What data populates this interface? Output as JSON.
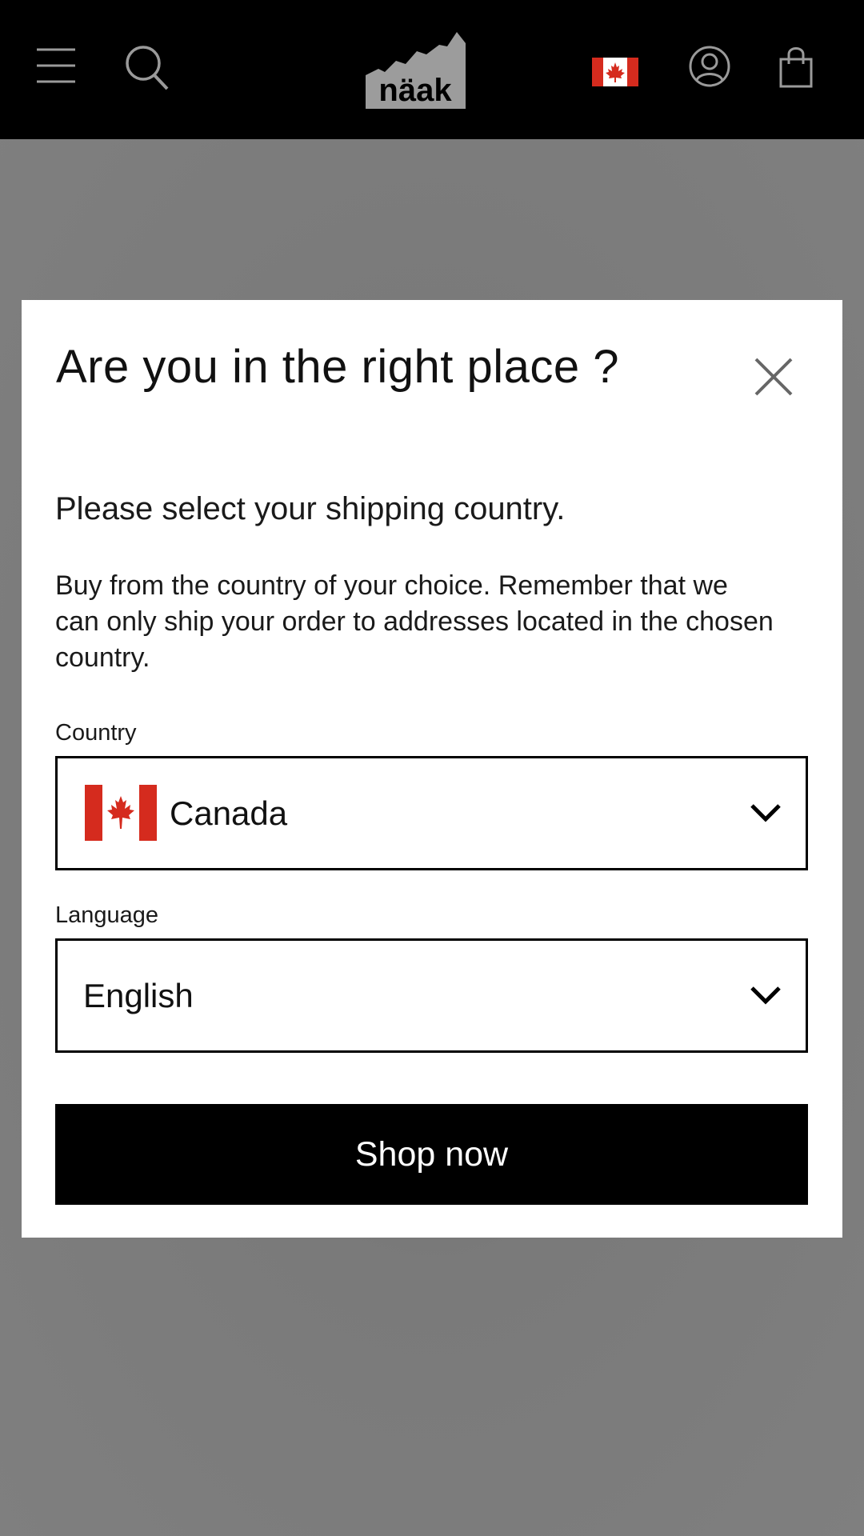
{
  "header": {
    "logo_text": "näak",
    "icons": {
      "menu": "hamburger-menu-icon",
      "search": "search-icon",
      "flag": "canada-flag-icon",
      "account": "account-icon",
      "cart": "shopping-bag-icon"
    },
    "background": "#000000"
  },
  "modal": {
    "title": "Are you in the right place ?",
    "subtitle": "Please select your shipping country.",
    "description": "Buy from the country of your choice. Remember that we can only ship your order to addresses located in the chosen country.",
    "country": {
      "label": "Country",
      "value": "Canada",
      "flag_icon": "canada-flag-icon"
    },
    "language": {
      "label": "Language",
      "value": "English"
    },
    "shop_button": "Shop now",
    "close_icon": "close-icon"
  },
  "colors": {
    "overlay": "#7d7d7d",
    "button": "#000000",
    "flag_red": "#d52b1e"
  }
}
